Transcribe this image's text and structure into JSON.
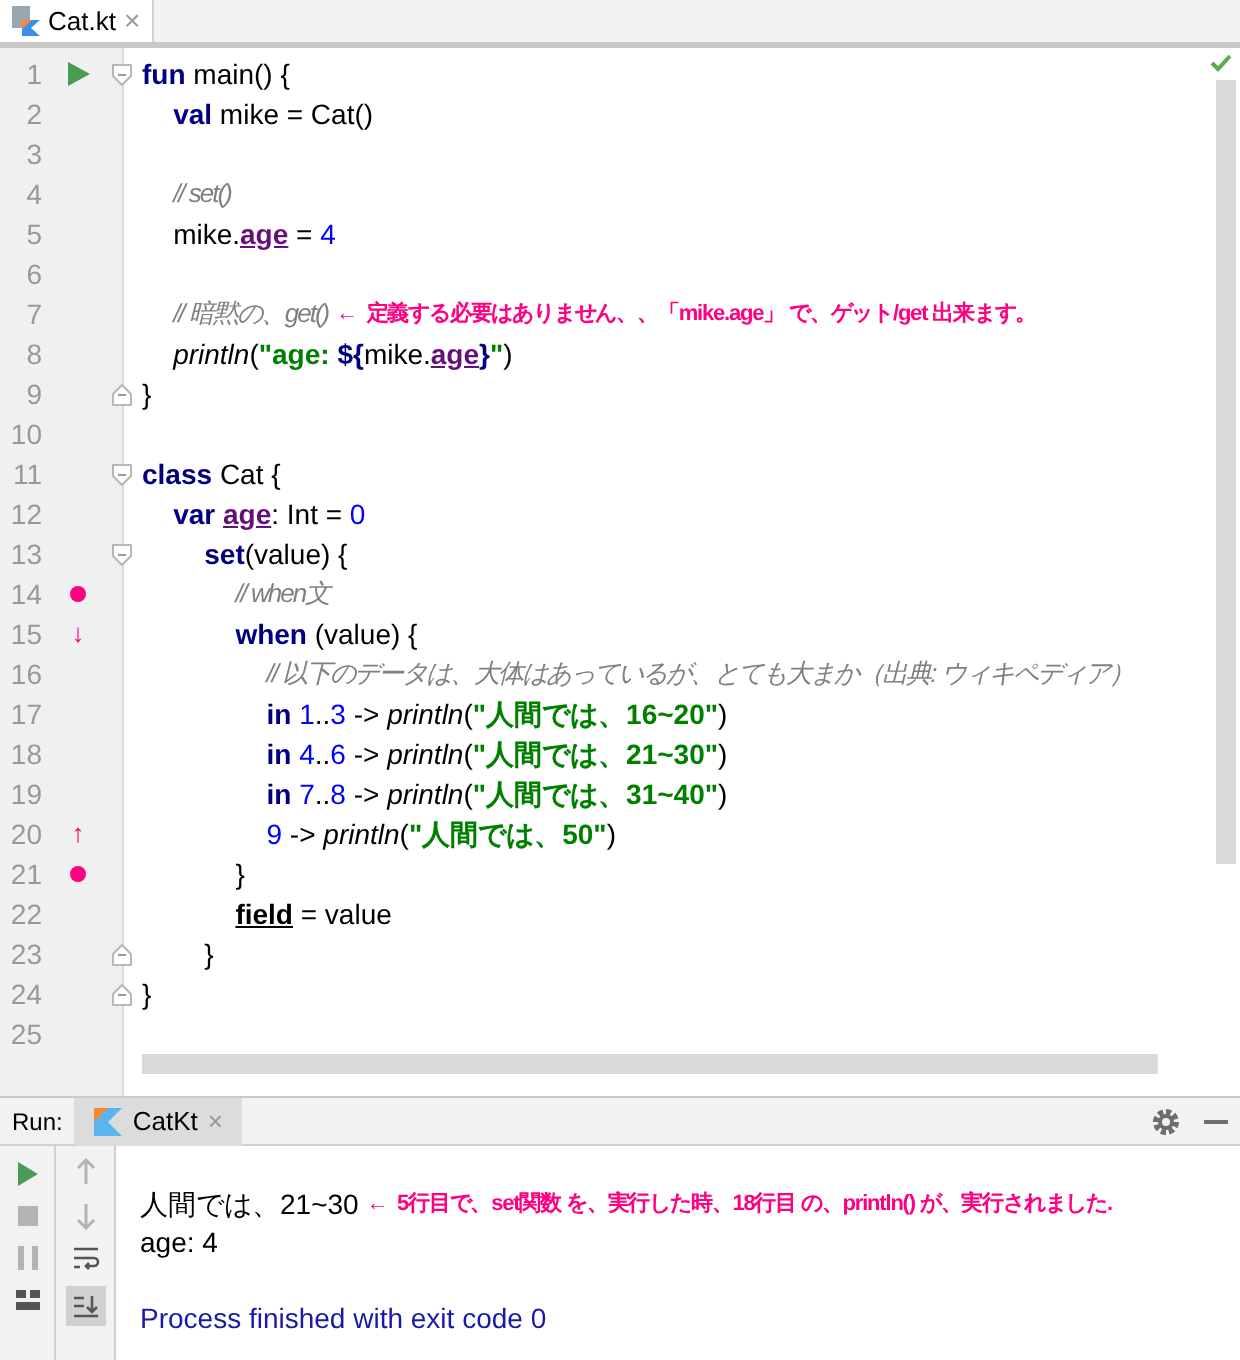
{
  "editor_tab": {
    "label": "Cat.kt",
    "close": "×",
    "selected": true
  },
  "status_check": true,
  "code_lines": [
    {
      "number": "1",
      "gutter": {
        "kind": "run"
      },
      "fold_open": true,
      "tokens": [
        {
          "kind": "keyword",
          "text": "fun"
        },
        {
          "kind": "plain",
          "text": " main() {"
        }
      ]
    },
    {
      "number": "2",
      "tokens": [
        {
          "kind": "keyword",
          "text": "    val"
        },
        {
          "kind": "plain",
          "text": " mike = Cat()"
        }
      ]
    },
    {
      "number": "3"
    },
    {
      "number": "4",
      "tokens": [
        {
          "kind": "comment",
          "text": "    // set()"
        }
      ]
    },
    {
      "number": "5",
      "tokens": [
        {
          "kind": "plain",
          "text": "    mike."
        },
        {
          "kind": "prop",
          "text": "age"
        },
        {
          "kind": "plain",
          "text": " = "
        },
        {
          "kind": "number",
          "text": "4"
        }
      ]
    },
    {
      "number": "6"
    },
    {
      "number": "7",
      "tokens": [
        {
          "kind": "comment",
          "text": "    // 暗黙の、get()"
        },
        {
          "kind": "note",
          "text": " ←  定義する必要はありません、、「mike.age」 で、ゲット/get 出来ます。"
        }
      ]
    },
    {
      "number": "8",
      "tokens": [
        {
          "kind": "call",
          "text": "    println"
        },
        {
          "kind": "plain",
          "text": "("
        },
        {
          "kind": "string",
          "text": "\"age: "
        },
        {
          "kind": "keyword",
          "text": "${"
        },
        {
          "kind": "plain",
          "text": "mike."
        },
        {
          "kind": "prop",
          "text": "age"
        },
        {
          "kind": "keyword",
          "text": "}"
        },
        {
          "kind": "string",
          "text": "\""
        },
        {
          "kind": "plain",
          "text": ")"
        }
      ]
    },
    {
      "number": "9",
      "fold_close": true,
      "tokens": [
        {
          "kind": "plain",
          "text": "}"
        }
      ]
    },
    {
      "number": "10"
    },
    {
      "number": "11",
      "fold_open": true,
      "tokens": [
        {
          "kind": "keyword",
          "text": "class"
        },
        {
          "kind": "plain",
          "text": " Cat {"
        }
      ]
    },
    {
      "number": "12",
      "tokens": [
        {
          "kind": "keyword",
          "text": "    var "
        },
        {
          "kind": "prop",
          "text": "age"
        },
        {
          "kind": "plain",
          "text": ": Int = "
        },
        {
          "kind": "number",
          "text": "0"
        }
      ]
    },
    {
      "number": "13",
      "fold_open": true,
      "tokens": [
        {
          "kind": "keyword",
          "text": "        set"
        },
        {
          "kind": "plain",
          "text": "(value) {"
        }
      ]
    },
    {
      "number": "14",
      "gutter": {
        "kind": "dot"
      },
      "tokens": [
        {
          "kind": "comment",
          "text": "            // when文"
        }
      ]
    },
    {
      "number": "15",
      "gutter": {
        "kind": "text",
        "text": "↓"
      },
      "tokens": [
        {
          "kind": "keyword",
          "text": "            when"
        },
        {
          "kind": "plain",
          "text": " (value) {"
        }
      ]
    },
    {
      "number": "16",
      "tokens": [
        {
          "kind": "comment",
          "text": "                // 以下のデータは、大体はあっているが、とても大まか（出典: ウィキペディア）"
        }
      ]
    },
    {
      "number": "17",
      "tokens": [
        {
          "kind": "keyword",
          "text": "                in"
        },
        {
          "kind": "number",
          "text": " 1"
        },
        {
          "kind": "plain",
          "text": ".."
        },
        {
          "kind": "number",
          "text": "3"
        },
        {
          "kind": "plain",
          "text": " -> "
        },
        {
          "kind": "call",
          "text": "println"
        },
        {
          "kind": "plain",
          "text": "("
        },
        {
          "kind": "string",
          "text": "\"人間では、16~20\""
        },
        {
          "kind": "plain",
          "text": ")"
        }
      ]
    },
    {
      "number": "18",
      "tokens": [
        {
          "kind": "keyword",
          "text": "                in"
        },
        {
          "kind": "number",
          "text": " 4"
        },
        {
          "kind": "plain",
          "text": ".."
        },
        {
          "kind": "number",
          "text": "6"
        },
        {
          "kind": "plain",
          "text": " -> "
        },
        {
          "kind": "call",
          "text": "println"
        },
        {
          "kind": "plain",
          "text": "("
        },
        {
          "kind": "string",
          "text": "\"人間では、21~30\""
        },
        {
          "kind": "plain",
          "text": ")"
        }
      ]
    },
    {
      "number": "19",
      "tokens": [
        {
          "kind": "keyword",
          "text": "                in"
        },
        {
          "kind": "number",
          "text": " 7"
        },
        {
          "kind": "plain",
          "text": ".."
        },
        {
          "kind": "number",
          "text": "8"
        },
        {
          "kind": "plain",
          "text": " -> "
        },
        {
          "kind": "call",
          "text": "println"
        },
        {
          "kind": "plain",
          "text": "("
        },
        {
          "kind": "string",
          "text": "\"人間では、31~40\""
        },
        {
          "kind": "plain",
          "text": ")"
        }
      ]
    },
    {
      "number": "20",
      "gutter": {
        "kind": "text",
        "text": "↑"
      },
      "tokens": [
        {
          "kind": "number",
          "text": "                9"
        },
        {
          "kind": "plain",
          "text": " -> "
        },
        {
          "kind": "call",
          "text": "println"
        },
        {
          "kind": "plain",
          "text": "("
        },
        {
          "kind": "string",
          "text": "\"人間では、50\""
        },
        {
          "kind": "plain",
          "text": ")"
        }
      ]
    },
    {
      "number": "21",
      "gutter": {
        "kind": "dot"
      },
      "tokens": [
        {
          "kind": "plain",
          "text": "            }"
        }
      ]
    },
    {
      "number": "22",
      "tokens": [
        {
          "kind": "field",
          "text": "            field"
        },
        {
          "kind": "plain",
          "text": " = value"
        }
      ]
    },
    {
      "number": "23",
      "fold_close": true,
      "tokens": [
        {
          "kind": "plain",
          "text": "        }"
        }
      ]
    },
    {
      "number": "24",
      "fold_close": true,
      "tokens": [
        {
          "kind": "plain",
          "text": "}"
        }
      ]
    },
    {
      "number": "25"
    }
  ],
  "run_panel": {
    "label": "Run:",
    "tab": {
      "label": "CatKt",
      "close": "×",
      "selected": true
    },
    "output": [
      [
        {
          "kind": "plain",
          "text": "人間では、21~30"
        },
        {
          "kind": "note",
          "text": " ←  5行目で、set関数 を、実行した時、18行目 の、println() が、実行されました."
        }
      ],
      [
        {
          "kind": "plain",
          "text": "age: 4"
        }
      ],
      [
        {
          "kind": "system",
          "text": "Process finished with exit code 0"
        }
      ]
    ]
  }
}
